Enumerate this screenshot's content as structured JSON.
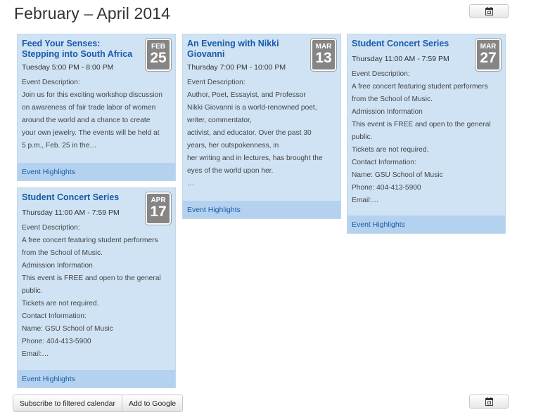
{
  "header": {
    "title": "February – April 2014"
  },
  "icons": {
    "calendar": "calendar-icon"
  },
  "events": [
    {
      "month": "FEB",
      "day": "25",
      "title": "Feed Your Senses: Stepping into South Africa",
      "time": "Tuesday 5:00 PM - 8:00 PM",
      "description": "Event Description:\nJoin us for this exciting workshop discussion\non awareness of fair trade labor of women\naround the world and a chance to create\nyour own jewelry. The events will be held at\n5 p.m., Feb. 25 in the…",
      "link": "Event Highlights"
    },
    {
      "month": "MAR",
      "day": "13",
      "title": "An Evening with Nikki Giovanni",
      "time": "Thursday 7:00 PM - 10:00 PM",
      "description": "Event Description:\nAuthor, Poet, Essayist, and Professor\nNikki Giovanni is a world-renowned poet,\nwriter, commentator,\nactivist, and educator. Over the past 30\nyears, her outspokenness, in\nher writing and in lectures, has brought the\neyes of the world upon her.\n…",
      "link": "Event Highlights"
    },
    {
      "month": "MAR",
      "day": "27",
      "title": "Student Concert Series",
      "time": "Thursday 11:00 AM - 7:59 PM",
      "description": "Event Description:\nA free concert featuring student performers\nfrom the School of Music.\nAdmission Information\nThis event is FREE and open to the general\npublic.\nTickets are not required.\nContact Information:\nName: GSU School of Music\nPhone: 404-413-5900\nEmail:…",
      "link": "Event Highlights"
    },
    {
      "month": "APR",
      "day": "17",
      "title": "Student Concert Series",
      "time": "Thursday 11:00 AM - 7:59 PM",
      "description": "Event Description:\nA free concert featuring student performers\nfrom the School of Music.\nAdmission Information\nThis event is FREE and open to the general\npublic.\nTickets are not required.\nContact Information:\nName: GSU School of Music\nPhone: 404-413-5900\nEmail:…",
      "link": "Event Highlights"
    }
  ],
  "footer": {
    "subscribe_label": "Subscribe to filtered calendar",
    "google_label": "Add to Google"
  },
  "colors": {
    "card_bg": "#cfe3f4",
    "card_footer_bg": "#b4d2ef",
    "link": "#1a5aa8",
    "badge_bg": "#858585"
  }
}
